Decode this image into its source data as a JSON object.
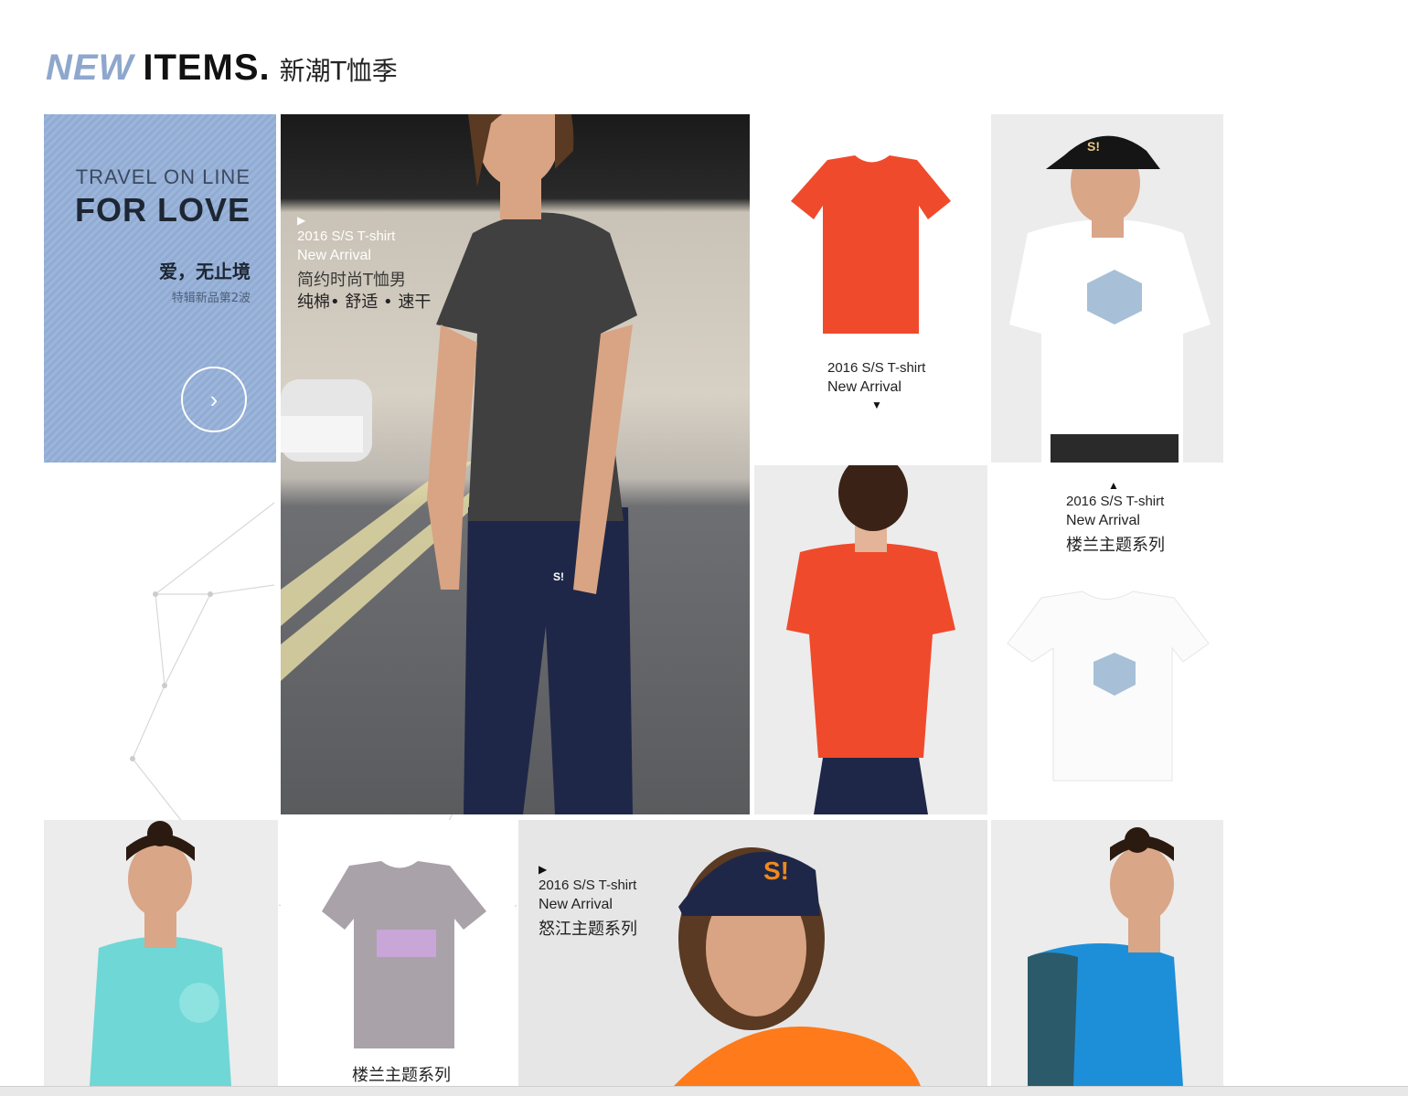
{
  "header": {
    "new": "NEW",
    "items": "ITEMS.",
    "cn": "新潮T恤季"
  },
  "promo": {
    "line1": "TRAVEL ON LINE",
    "line2": "FOR LOVE",
    "line3": "爱，无止境",
    "line4": "特辑新品第2波",
    "arrow": "›"
  },
  "hero": {
    "marker": "▶",
    "tag": "2016  S/S T-shirt",
    "arrival": "New Arrival",
    "desc1": "简约时尚T恤男",
    "desc2": "纯棉• 舒适 • 速干"
  },
  "red_tee": {
    "tag": "2016  S/S T-shirt",
    "arrival": "New Arrival",
    "marker": "▼"
  },
  "white_tee": {
    "marker": "▲",
    "tag": "2016  S/S T-shirt",
    "arrival": "New Arrival",
    "series": "楼兰主题系列"
  },
  "grey_tee": {
    "series": "楼兰主题系列"
  },
  "cap_tile": {
    "marker": "▶",
    "tag": "2016  S/S T-shirt",
    "arrival": "New Arrival",
    "series": "怒江主题系列"
  },
  "logo_letter": "S!",
  "colors": {
    "accent_blue": "#8fa7cc",
    "red_shirt": "#f04a2c",
    "grey_shirt": "#404040",
    "navy": "#1f2748",
    "cyan_shirt": "#6fd7d6",
    "blue_shirt": "#1d8fd8",
    "orange_shirt": "#ff7a1a"
  }
}
